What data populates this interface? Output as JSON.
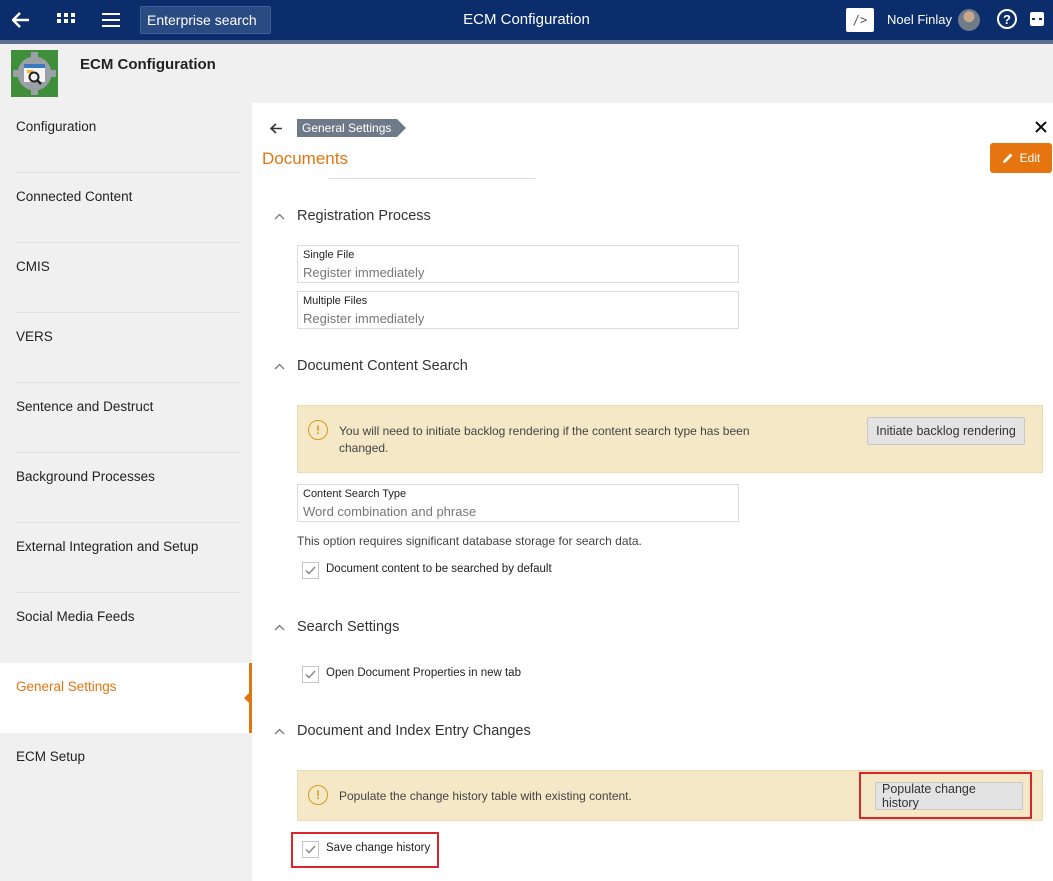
{
  "topbar": {
    "search_label": "Enterprise search",
    "title": "ECM Configuration",
    "code_label": "/>",
    "user_name": "Noel Finlay",
    "help_label": "?"
  },
  "app": {
    "title": "ECM Configuration"
  },
  "sidebar": {
    "items": [
      {
        "label": "Configuration"
      },
      {
        "label": "Connected Content"
      },
      {
        "label": "CMIS"
      },
      {
        "label": "VERS"
      },
      {
        "label": "Sentence and Destruct"
      },
      {
        "label": "Background Processes"
      },
      {
        "label": "External Integration and Setup"
      },
      {
        "label": "Social Media Feeds"
      },
      {
        "label": "General Settings",
        "active": true
      },
      {
        "label": "ECM Setup"
      }
    ]
  },
  "main": {
    "breadcrumb": "General Settings",
    "title": "Documents",
    "edit_label": "Edit",
    "sections": {
      "registration": {
        "title": "Registration Process",
        "single_label": "Single File",
        "single_value": "Register immediately",
        "multiple_label": "Multiple Files",
        "multiple_value": "Register immediately"
      },
      "content_search": {
        "title": "Document Content Search",
        "notice": "You will need to initiate backlog rendering if the content search type has been changed.",
        "notice_button": "Initiate backlog rendering",
        "type_label": "Content Search Type",
        "type_value": "Word combination and phrase",
        "help": "This option requires significant database storage for search data.",
        "checkbox_label": "Document content to be searched by default",
        "checkbox_checked": true
      },
      "search_settings": {
        "title": "Search Settings",
        "checkbox_label": "Open Document Properties in new tab",
        "checkbox_checked": true
      },
      "changes": {
        "title": "Document and Index Entry Changes",
        "notice": "Populate the change history table with existing content.",
        "notice_button": "Populate change history",
        "checkbox_label": "Save change history",
        "checkbox_checked": true
      }
    }
  },
  "colors": {
    "accent": "#e07512",
    "topbar": "#0b2d6b",
    "highlight": "#d9262b",
    "notice_bg": "#f4e8c7"
  }
}
